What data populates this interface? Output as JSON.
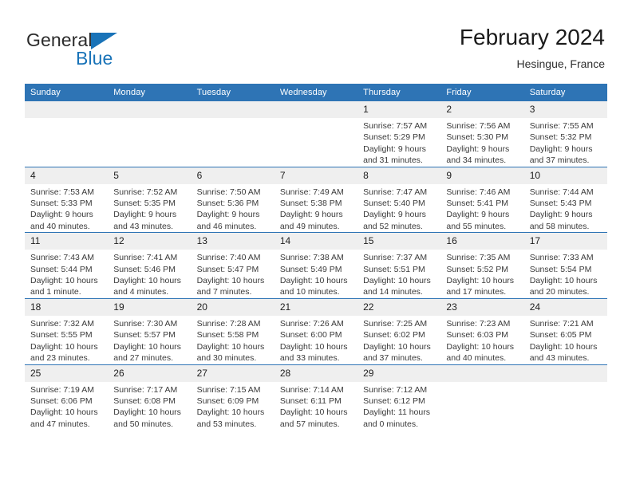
{
  "brand": {
    "name_top": "General",
    "name_bottom": "Blue",
    "accent_color": "#1973b8"
  },
  "header": {
    "title": "February 2024",
    "subtitle": "Hesingue, France"
  },
  "calendar": {
    "header_color": "#2e74b5",
    "weekdays": [
      "Sunday",
      "Monday",
      "Tuesday",
      "Wednesday",
      "Thursday",
      "Friday",
      "Saturday"
    ],
    "weeks": [
      [
        {
          "day": "",
          "empty": true
        },
        {
          "day": "",
          "empty": true
        },
        {
          "day": "",
          "empty": true
        },
        {
          "day": "",
          "empty": true
        },
        {
          "day": "1",
          "sunrise": "Sunrise: 7:57 AM",
          "sunset": "Sunset: 5:29 PM",
          "daylight": "Daylight: 9 hours and 31 minutes."
        },
        {
          "day": "2",
          "sunrise": "Sunrise: 7:56 AM",
          "sunset": "Sunset: 5:30 PM",
          "daylight": "Daylight: 9 hours and 34 minutes."
        },
        {
          "day": "3",
          "sunrise": "Sunrise: 7:55 AM",
          "sunset": "Sunset: 5:32 PM",
          "daylight": "Daylight: 9 hours and 37 minutes."
        }
      ],
      [
        {
          "day": "4",
          "sunrise": "Sunrise: 7:53 AM",
          "sunset": "Sunset: 5:33 PM",
          "daylight": "Daylight: 9 hours and 40 minutes."
        },
        {
          "day": "5",
          "sunrise": "Sunrise: 7:52 AM",
          "sunset": "Sunset: 5:35 PM",
          "daylight": "Daylight: 9 hours and 43 minutes."
        },
        {
          "day": "6",
          "sunrise": "Sunrise: 7:50 AM",
          "sunset": "Sunset: 5:36 PM",
          "daylight": "Daylight: 9 hours and 46 minutes."
        },
        {
          "day": "7",
          "sunrise": "Sunrise: 7:49 AM",
          "sunset": "Sunset: 5:38 PM",
          "daylight": "Daylight: 9 hours and 49 minutes."
        },
        {
          "day": "8",
          "sunrise": "Sunrise: 7:47 AM",
          "sunset": "Sunset: 5:40 PM",
          "daylight": "Daylight: 9 hours and 52 minutes."
        },
        {
          "day": "9",
          "sunrise": "Sunrise: 7:46 AM",
          "sunset": "Sunset: 5:41 PM",
          "daylight": "Daylight: 9 hours and 55 minutes."
        },
        {
          "day": "10",
          "sunrise": "Sunrise: 7:44 AM",
          "sunset": "Sunset: 5:43 PM",
          "daylight": "Daylight: 9 hours and 58 minutes."
        }
      ],
      [
        {
          "day": "11",
          "sunrise": "Sunrise: 7:43 AM",
          "sunset": "Sunset: 5:44 PM",
          "daylight": "Daylight: 10 hours and 1 minute."
        },
        {
          "day": "12",
          "sunrise": "Sunrise: 7:41 AM",
          "sunset": "Sunset: 5:46 PM",
          "daylight": "Daylight: 10 hours and 4 minutes."
        },
        {
          "day": "13",
          "sunrise": "Sunrise: 7:40 AM",
          "sunset": "Sunset: 5:47 PM",
          "daylight": "Daylight: 10 hours and 7 minutes."
        },
        {
          "day": "14",
          "sunrise": "Sunrise: 7:38 AM",
          "sunset": "Sunset: 5:49 PM",
          "daylight": "Daylight: 10 hours and 10 minutes."
        },
        {
          "day": "15",
          "sunrise": "Sunrise: 7:37 AM",
          "sunset": "Sunset: 5:51 PM",
          "daylight": "Daylight: 10 hours and 14 minutes."
        },
        {
          "day": "16",
          "sunrise": "Sunrise: 7:35 AM",
          "sunset": "Sunset: 5:52 PM",
          "daylight": "Daylight: 10 hours and 17 minutes."
        },
        {
          "day": "17",
          "sunrise": "Sunrise: 7:33 AM",
          "sunset": "Sunset: 5:54 PM",
          "daylight": "Daylight: 10 hours and 20 minutes."
        }
      ],
      [
        {
          "day": "18",
          "sunrise": "Sunrise: 7:32 AM",
          "sunset": "Sunset: 5:55 PM",
          "daylight": "Daylight: 10 hours and 23 minutes."
        },
        {
          "day": "19",
          "sunrise": "Sunrise: 7:30 AM",
          "sunset": "Sunset: 5:57 PM",
          "daylight": "Daylight: 10 hours and 27 minutes."
        },
        {
          "day": "20",
          "sunrise": "Sunrise: 7:28 AM",
          "sunset": "Sunset: 5:58 PM",
          "daylight": "Daylight: 10 hours and 30 minutes."
        },
        {
          "day": "21",
          "sunrise": "Sunrise: 7:26 AM",
          "sunset": "Sunset: 6:00 PM",
          "daylight": "Daylight: 10 hours and 33 minutes."
        },
        {
          "day": "22",
          "sunrise": "Sunrise: 7:25 AM",
          "sunset": "Sunset: 6:02 PM",
          "daylight": "Daylight: 10 hours and 37 minutes."
        },
        {
          "day": "23",
          "sunrise": "Sunrise: 7:23 AM",
          "sunset": "Sunset: 6:03 PM",
          "daylight": "Daylight: 10 hours and 40 minutes."
        },
        {
          "day": "24",
          "sunrise": "Sunrise: 7:21 AM",
          "sunset": "Sunset: 6:05 PM",
          "daylight": "Daylight: 10 hours and 43 minutes."
        }
      ],
      [
        {
          "day": "25",
          "sunrise": "Sunrise: 7:19 AM",
          "sunset": "Sunset: 6:06 PM",
          "daylight": "Daylight: 10 hours and 47 minutes."
        },
        {
          "day": "26",
          "sunrise": "Sunrise: 7:17 AM",
          "sunset": "Sunset: 6:08 PM",
          "daylight": "Daylight: 10 hours and 50 minutes."
        },
        {
          "day": "27",
          "sunrise": "Sunrise: 7:15 AM",
          "sunset": "Sunset: 6:09 PM",
          "daylight": "Daylight: 10 hours and 53 minutes."
        },
        {
          "day": "28",
          "sunrise": "Sunrise: 7:14 AM",
          "sunset": "Sunset: 6:11 PM",
          "daylight": "Daylight: 10 hours and 57 minutes."
        },
        {
          "day": "29",
          "sunrise": "Sunrise: 7:12 AM",
          "sunset": "Sunset: 6:12 PM",
          "daylight": "Daylight: 11 hours and 0 minutes."
        },
        {
          "day": "",
          "empty": true
        },
        {
          "day": "",
          "empty": true
        }
      ]
    ]
  }
}
